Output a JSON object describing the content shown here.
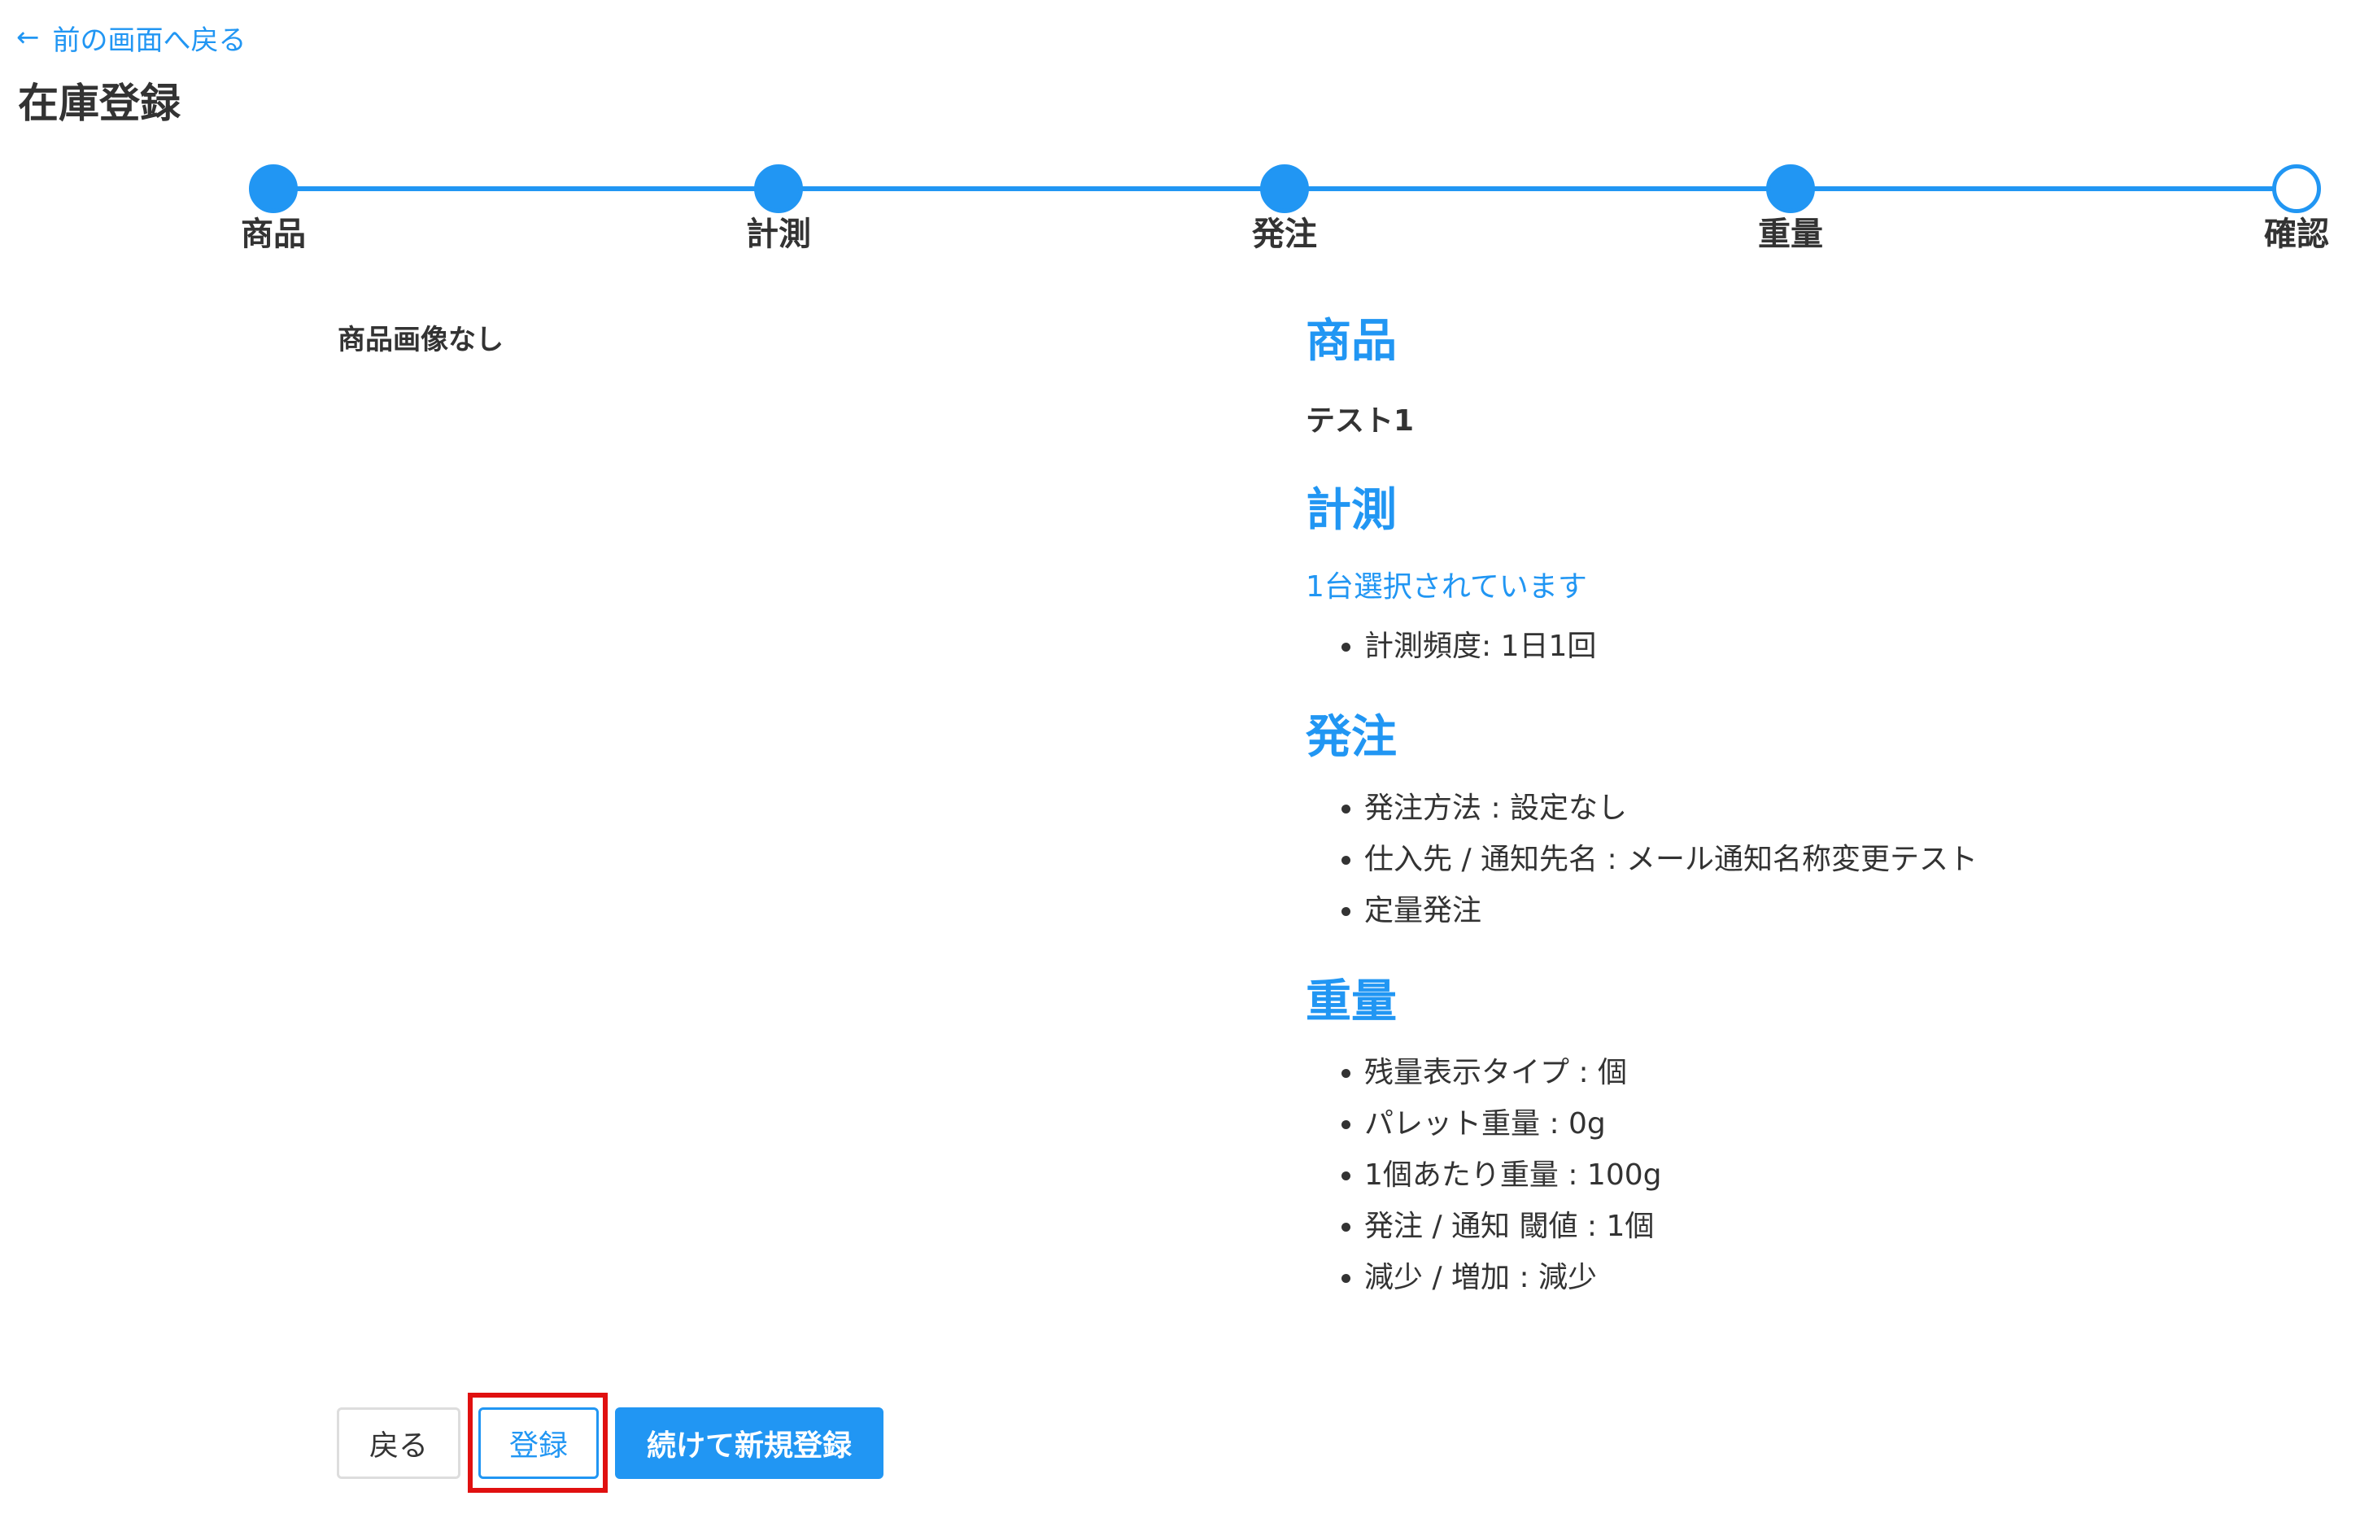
{
  "header": {
    "back_link_label": "前の画面へ戻る",
    "page_title": "在庫登録"
  },
  "stepper": {
    "steps": [
      {
        "label": "商品",
        "completed": true
      },
      {
        "label": "計測",
        "completed": true
      },
      {
        "label": "発注",
        "completed": true
      },
      {
        "label": "重量",
        "completed": true
      },
      {
        "label": "確認",
        "completed": false
      }
    ]
  },
  "image_panel": {
    "no_image_text": "商品画像なし"
  },
  "details": {
    "product": {
      "heading": "商品",
      "name": "テスト1"
    },
    "measurement": {
      "heading": "計測",
      "selected_text": "1台選択されています",
      "items": [
        "計測頻度: 1日1回"
      ]
    },
    "order": {
      "heading": "発注",
      "items": [
        "発注方法 : 設定なし",
        "仕入先 / 通知先名 : メール通知名称変更テスト",
        "定量発注"
      ]
    },
    "weight": {
      "heading": "重量",
      "items": [
        "残量表示タイプ : 個",
        "パレット重量 : 0g",
        "1個あたり重量 : 100g",
        "発注 / 通知 閾値 : 1個",
        "減少 / 増加 : 減少"
      ]
    }
  },
  "buttons": {
    "back_label": "戻る",
    "register_label": "登録",
    "continue_label": "続けて新規登録"
  },
  "colors": {
    "accent": "#2196f3",
    "highlight": "#e01010",
    "text": "#333333"
  }
}
